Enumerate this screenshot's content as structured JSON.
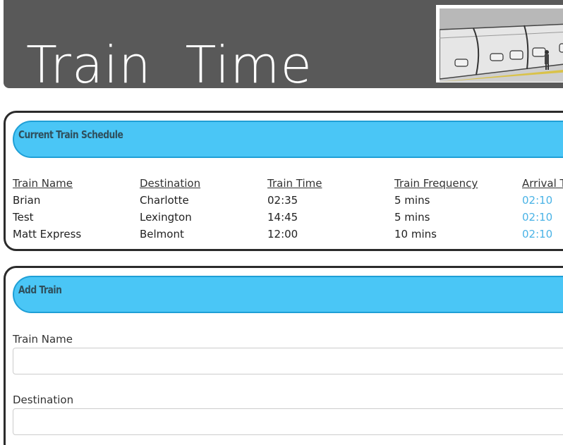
{
  "header": {
    "title": "Train  Time",
    "image": "train-photo"
  },
  "schedule": {
    "heading": "Current Train Schedule",
    "columns": [
      "Train Name",
      "Destination",
      "Train Time",
      "Train Frequency",
      "Arrival T"
    ],
    "rows": [
      [
        "Brian",
        "Charlotte",
        "02:35",
        "5 mins",
        "02:10"
      ],
      [
        "Test",
        "Lexington",
        "14:45",
        "5 mins",
        "02:10"
      ],
      [
        "Matt Express",
        "Belmont",
        "12:00",
        "10 mins",
        "02:10"
      ]
    ]
  },
  "add_train": {
    "heading": "Add Train",
    "fields": [
      {
        "label": "Train Name",
        "value": ""
      },
      {
        "label": "Destination",
        "value": ""
      }
    ]
  },
  "colors": {
    "header_bg": "#595959",
    "panel_heading_bg": "#4ac6f6",
    "arrival_text": "#4ab3e6"
  }
}
